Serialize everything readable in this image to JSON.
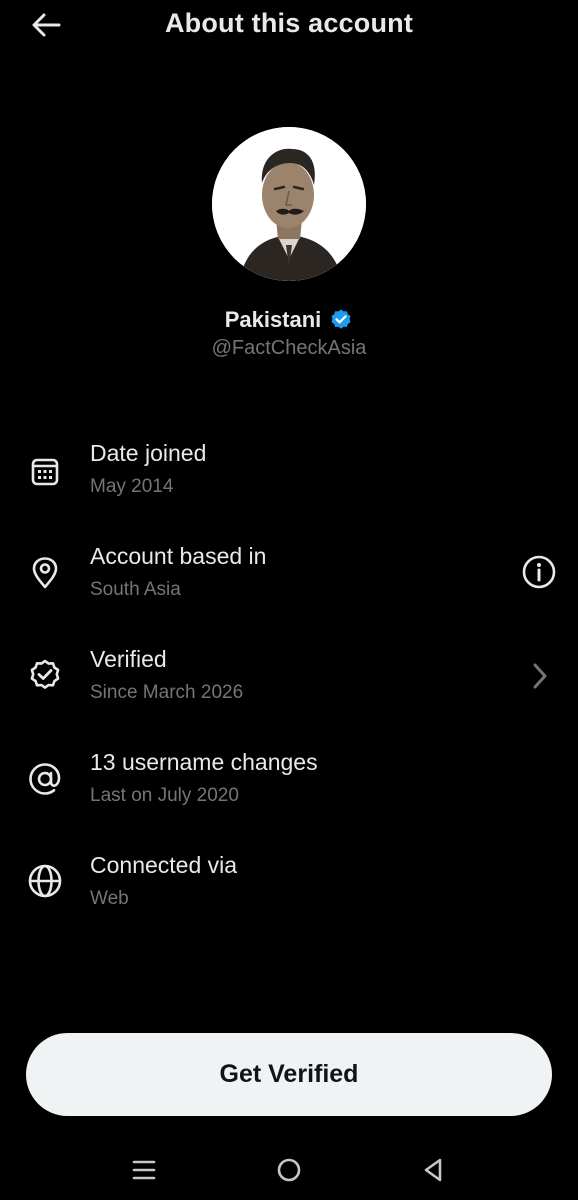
{
  "header": {
    "title": "About this account",
    "back_icon": "arrow-left-icon"
  },
  "profile": {
    "display_name": "Pakistani",
    "handle": "@FactCheckAsia",
    "verified_badge_color": "#1d9bf0"
  },
  "info_items": [
    {
      "icon": "calendar-icon",
      "label": "Date joined",
      "sub": "May 2014"
    },
    {
      "icon": "location-pin-icon",
      "label": "Account based in",
      "sub": "South Asia",
      "trailing_icon": "info-icon"
    },
    {
      "icon": "verified-seal-icon",
      "label": "Verified",
      "sub": "Since March 2026",
      "trailing_icon": "chevron-right-icon"
    },
    {
      "icon": "at-sign-icon",
      "label": "13 username changes",
      "sub": "Last on July 2020"
    },
    {
      "icon": "globe-icon",
      "label": "Connected via",
      "sub": "Web"
    }
  ],
  "cta": {
    "label": "Get Verified"
  },
  "system_nav": {
    "recents_icon": "menu-lines-icon",
    "home_icon": "home-circle-icon",
    "back_icon": "back-triangle-icon"
  },
  "colors": {
    "background": "#000000",
    "primary_text": "#e7e9ea",
    "secondary_text": "#71767b",
    "button_bg": "#eff3f4",
    "button_text": "#0f1419"
  }
}
